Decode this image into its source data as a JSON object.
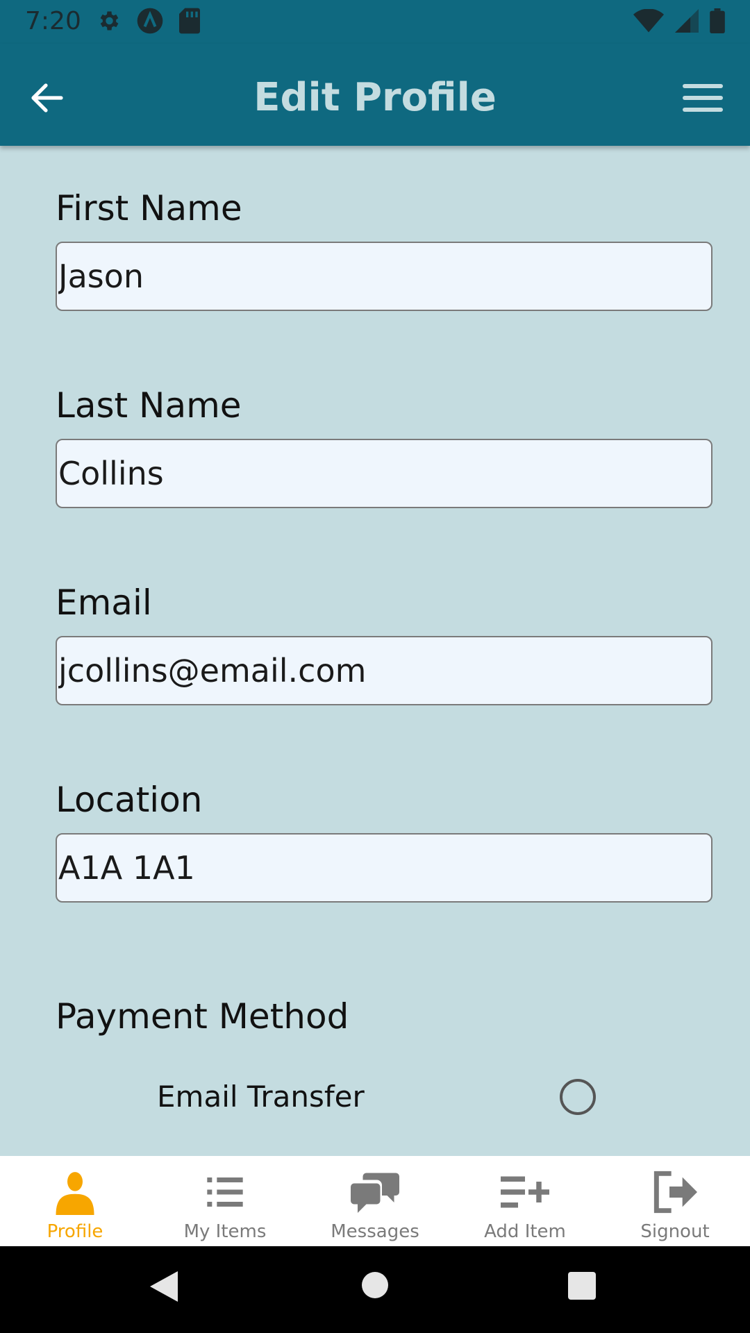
{
  "status_bar": {
    "time": "7:20",
    "icons_left": [
      "gear-icon",
      "a-letter-icon",
      "sd-card-icon"
    ],
    "icons_right": [
      "wifi-icon",
      "signal-icon",
      "battery-icon"
    ]
  },
  "app_bar": {
    "title": "Edit Profile",
    "back_icon": "arrow-left-icon",
    "menu_icon": "hamburger-icon"
  },
  "form": {
    "first_name": {
      "label": "First Name",
      "value": "Jason"
    },
    "last_name": {
      "label": "Last Name",
      "value": "Collins"
    },
    "email": {
      "label": "Email",
      "value": "jcollins@email.com"
    },
    "location": {
      "label": "Location",
      "value": "A1A 1A1"
    },
    "payment": {
      "title": "Payment Method",
      "options": [
        {
          "label": "Email Transfer",
          "selected": false
        }
      ]
    }
  },
  "bottom_nav": {
    "items": [
      {
        "label": "Profile",
        "icon": "person-icon",
        "active": true
      },
      {
        "label": "My Items",
        "icon": "list-icon",
        "active": false
      },
      {
        "label": "Messages",
        "icon": "chat-icon",
        "active": false
      },
      {
        "label": "Add Item",
        "icon": "add-list-icon",
        "active": false
      },
      {
        "label": "Signout",
        "icon": "signout-icon",
        "active": false
      }
    ]
  },
  "colors": {
    "primary": "#0f6980",
    "background": "#c4dce0",
    "input_bg": "#eff6fd",
    "active": "#f7a600",
    "inactive": "#7a7a7a"
  }
}
